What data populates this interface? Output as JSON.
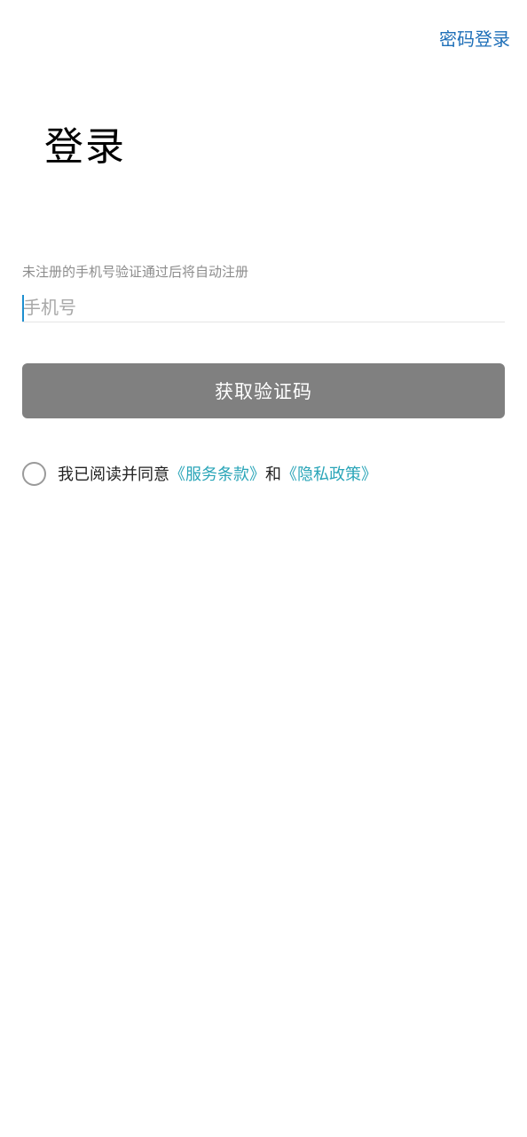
{
  "header": {
    "password_login_link": "密码登录"
  },
  "main": {
    "title": "登录",
    "hint": "未注册的手机号验证通过后将自动注册",
    "phone_placeholder": "手机号",
    "get_code_button": "获取验证码"
  },
  "agreement": {
    "prefix": "我已阅读并同意",
    "service_terms": "《服务条款》",
    "conjunction": "和",
    "privacy_policy": "《隐私政策》",
    "checked": false
  },
  "colors": {
    "link": "#1e6fb8",
    "terms_link": "#2aa5b8",
    "button_bg": "#808080",
    "caret": "#1e8fd0"
  }
}
